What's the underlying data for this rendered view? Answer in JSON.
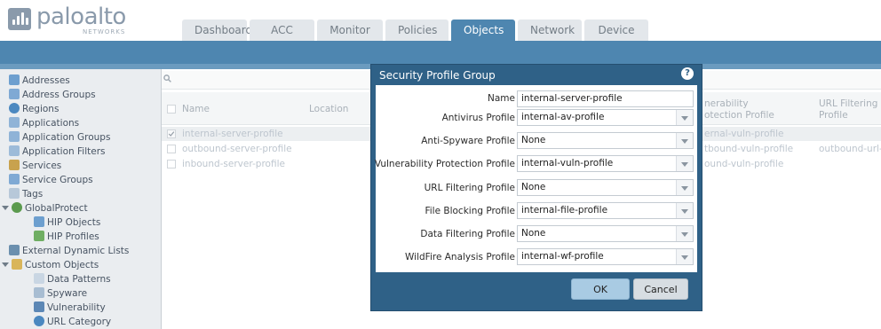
{
  "header": {
    "logo": "paloalto",
    "logo_sub": "NETWORKS",
    "tabs": [
      {
        "label": "Dashboard",
        "active": false
      },
      {
        "label": "ACC",
        "active": false
      },
      {
        "label": "Monitor",
        "active": false
      },
      {
        "label": "Policies",
        "active": false
      },
      {
        "label": "Objects",
        "active": true
      },
      {
        "label": "Network",
        "active": false
      },
      {
        "label": "Device",
        "active": false
      }
    ]
  },
  "sidebar": {
    "items": [
      {
        "label": "Addresses",
        "icon": "addresses-icon"
      },
      {
        "label": "Address Groups",
        "icon": "address-groups-icon"
      },
      {
        "label": "Regions",
        "icon": "regions-icon"
      },
      {
        "label": "Applications",
        "icon": "applications-icon"
      },
      {
        "label": "Application Groups",
        "icon": "application-groups-icon"
      },
      {
        "label": "Application Filters",
        "icon": "application-filters-icon"
      },
      {
        "label": "Services",
        "icon": "services-icon"
      },
      {
        "label": "Service Groups",
        "icon": "service-groups-icon"
      },
      {
        "label": "Tags",
        "icon": "tags-icon"
      },
      {
        "label": "GlobalProtect",
        "icon": "globalprotect-icon"
      },
      {
        "label": "HIP Objects",
        "icon": "hip-objects-icon"
      },
      {
        "label": "HIP Profiles",
        "icon": "hip-profiles-icon"
      },
      {
        "label": "External Dynamic Lists",
        "icon": "external-dynamic-lists-icon"
      },
      {
        "label": "Custom Objects",
        "icon": "custom-objects-icon"
      },
      {
        "label": "Data Patterns",
        "icon": "data-patterns-icon"
      },
      {
        "label": "Spyware",
        "icon": "spyware-icon"
      },
      {
        "label": "Vulnerability",
        "icon": "vulnerability-icon"
      },
      {
        "label": "URL Category",
        "icon": "url-category-icon"
      }
    ]
  },
  "table": {
    "columns": {
      "name": "Name",
      "location": "Location",
      "vuln_line1": "nerability",
      "vuln_line2": "otection Profile",
      "url_line1": "URL Filtering",
      "url_line2": "Profile"
    },
    "rows": [
      {
        "name": "internal-server-profile",
        "vuln": "ernal-vuln-profile",
        "url": "",
        "checked": true
      },
      {
        "name": "outbound-server-profile",
        "vuln": "tbound-vuln-profile",
        "url": "outbound-url-pro",
        "checked": false
      },
      {
        "name": "inbound-server-profile",
        "vuln": "ound-vuln-profile",
        "url": "",
        "checked": false
      }
    ]
  },
  "dialog": {
    "title": "Security Profile Group",
    "help": "?",
    "fields": [
      {
        "label": "Name",
        "value": "internal-server-profile",
        "dropdown": false
      },
      {
        "label": "Antivirus Profile",
        "value": "internal-av-profile",
        "dropdown": true
      },
      {
        "label": "Anti-Spyware Profile",
        "value": "None",
        "dropdown": true
      },
      {
        "label": "Vulnerability Protection Profile",
        "value": "internal-vuln-profile",
        "dropdown": true
      },
      {
        "label": "URL Filtering Profile",
        "value": "None",
        "dropdown": true
      },
      {
        "label": "File Blocking Profile",
        "value": "internal-file-profile",
        "dropdown": true
      },
      {
        "label": "Data Filtering Profile",
        "value": "None",
        "dropdown": true
      },
      {
        "label": "WildFire Analysis Profile",
        "value": "internal-wf-profile",
        "dropdown": true
      }
    ],
    "ok_label": "OK",
    "cancel_label": "Cancel"
  }
}
